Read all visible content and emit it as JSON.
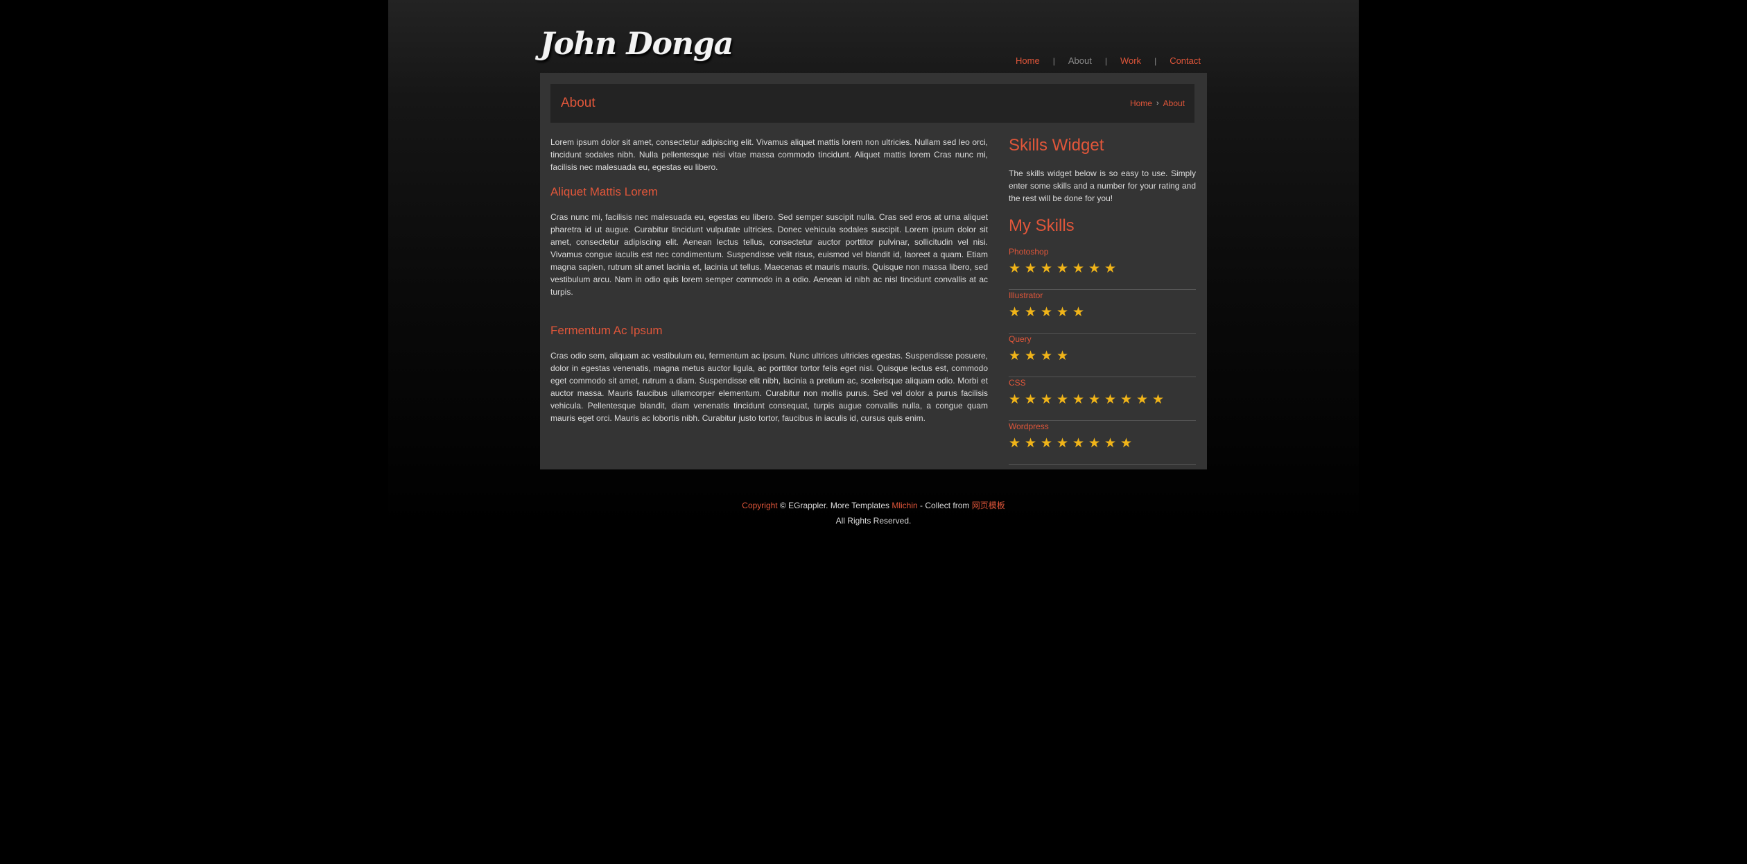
{
  "logo": {
    "text": "John Donga"
  },
  "nav": {
    "items": [
      {
        "label": "Home"
      },
      {
        "label": "About"
      },
      {
        "label": "Work"
      },
      {
        "label": "Contact"
      }
    ],
    "separator": "|"
  },
  "page": {
    "title": "About",
    "breadcrumb": {
      "home": "Home",
      "separator": "›",
      "current": "About"
    }
  },
  "main": {
    "intro": "Lorem ipsum dolor sit amet, consectetur adipiscing elit. Vivamus aliquet mattis lorem non ultricies. Nullam sed leo orci, tincidunt sodales nibh. Nulla pellentesque nisi vitae massa commodo tincidunt. Aliquet mattis lorem Cras nunc mi, facilisis nec malesuada eu, egestas eu libero.",
    "heading_1": "Aliquet Mattis Lorem",
    "para_1": "Cras nunc mi, facilisis nec malesuada eu, egestas eu libero. Sed semper suscipit nulla. Cras sed eros at urna aliquet pharetra id ut augue. Curabitur tincidunt vulputate ultricies. Donec vehicula sodales suscipit. Lorem ipsum dolor sit amet, consectetur adipiscing elit. Aenean lectus tellus, consectetur auctor porttitor pulvinar, sollicitudin vel nisi. Vivamus congue iaculis est nec condimentum. Suspendisse velit risus, euismod vel blandit id, laoreet a quam. Etiam magna sapien, rutrum sit amet lacinia et, lacinia ut tellus. Maecenas et mauris mauris. Quisque non massa libero, sed vestibulum arcu. Nam in odio quis lorem semper commodo in a odio. Aenean id nibh ac nisl tincidunt convallis at ac turpis.",
    "heading_2": "Fermentum Ac Ipsum",
    "para_2": "Cras odio sem, aliquam ac vestibulum eu, fermentum ac ipsum. Nunc ultrices ultricies egestas. Suspendisse posuere, dolor in egestas venenatis, magna metus auctor ligula, ac porttitor tortor felis eget nisl. Quisque lectus est, commodo eget commodo sit amet, rutrum a diam. Suspendisse elit nibh, lacinia a pretium ac, scelerisque aliquam odio. Morbi et auctor massa. Mauris faucibus ullamcorper elementum. Curabitur non mollis purus. Sed vel dolor a purus facilisis vehicula. Pellentesque blandit, diam venenatis tincidunt consequat, turpis augue convallis nulla, a congue quam mauris eget orci. Mauris ac lobortis nibh. Curabitur justo tortor, faucibus in iaculis id, cursus quis enim."
  },
  "sidebar": {
    "widget_title": "Skills Widget",
    "widget_intro": "The skills widget below is so easy to use. Simply enter some skills and a number for your rating and the rest will be done for you!",
    "skills_title": "My Skills",
    "star_glyph": "★",
    "star_color": "#f0b419",
    "skills": [
      {
        "name": "Photoshop",
        "rating": 7
      },
      {
        "name": "Illustrator",
        "rating": 5
      },
      {
        "name": "Query",
        "rating": 4
      },
      {
        "name": "CSS",
        "rating": 10
      },
      {
        "name": "Wordpress",
        "rating": 8
      }
    ]
  },
  "footer": {
    "copyright_link": "Copyright",
    "text_1": " © EGrappler. More Templates ",
    "templates_link": "Mlichin",
    "text_2": " - Collect from ",
    "collect_link": "网页模板",
    "line_2": "All Rights Reserved."
  },
  "colors": {
    "accent": "#e0563a",
    "panel": "#343434",
    "titlebar": "#232323",
    "background": "#000000"
  }
}
